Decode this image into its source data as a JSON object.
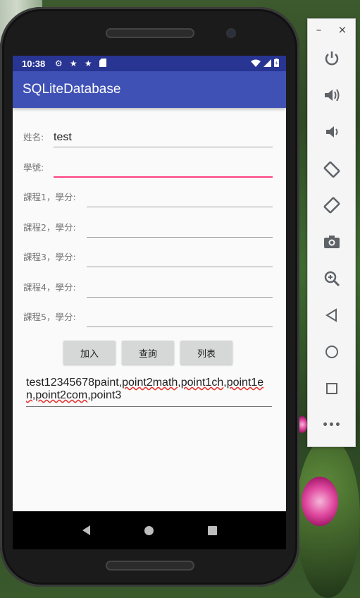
{
  "status_bar": {
    "time": "10:38"
  },
  "app_bar": {
    "title": "SQLiteDatabase"
  },
  "form": {
    "name_label": "姓名:",
    "name_value": "test",
    "id_label": "學號:",
    "id_value": "",
    "course1_label": "課程1，學分:",
    "course2_label": "課程2，學分:",
    "course3_label": "課程3，學分:",
    "course4_label": "課程4，學分:",
    "course5_label": "課程5，學分:"
  },
  "buttons": {
    "add": "加入",
    "query": "查詢",
    "list": "列表"
  },
  "result": {
    "p1": "test12345678paint,",
    "p2": "point2math",
    "p3": ",",
    "p4": "point1ch",
    "p5": ",",
    "p6": "point1en",
    "p7": ",",
    "p8": "point2com",
    "p9": ",",
    "p10": "point3"
  },
  "emulator": {
    "minimize": "–",
    "close": "×",
    "more": "•••"
  },
  "colors": {
    "status_bar": "#283593",
    "app_bar": "#3f51b5",
    "accent": "#ff4081"
  }
}
